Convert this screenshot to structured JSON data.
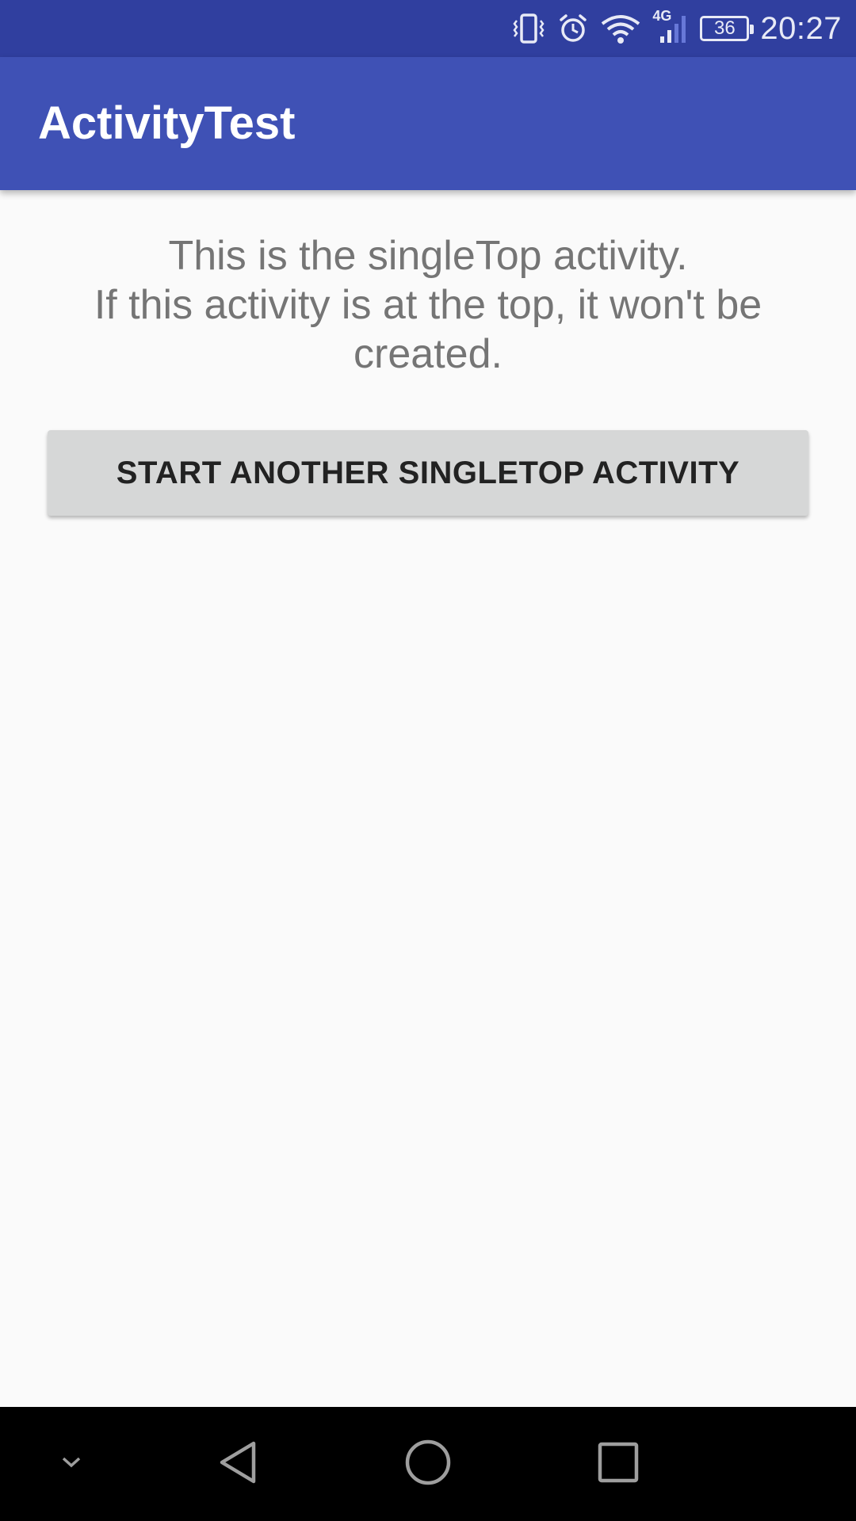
{
  "status_bar": {
    "network_type": "4G",
    "battery_level": "36",
    "time": "20:27",
    "icons": [
      "vibrate-icon",
      "alarm-icon",
      "wifi-icon",
      "signal-icon",
      "battery-icon"
    ],
    "color": "#303f9f"
  },
  "app_bar": {
    "title": "ActivityTest",
    "color": "#3f51b5"
  },
  "content": {
    "message_lines": [
      "This is the singleTop activity.",
      "If this activity is at the top, it won't be",
      "created."
    ],
    "button_label": "START ANOTHER SINGLETOP ACTIVITY"
  },
  "nav_bar": {
    "icons": [
      "hide-nav-icon",
      "back-icon",
      "home-icon",
      "recents-icon"
    ]
  }
}
